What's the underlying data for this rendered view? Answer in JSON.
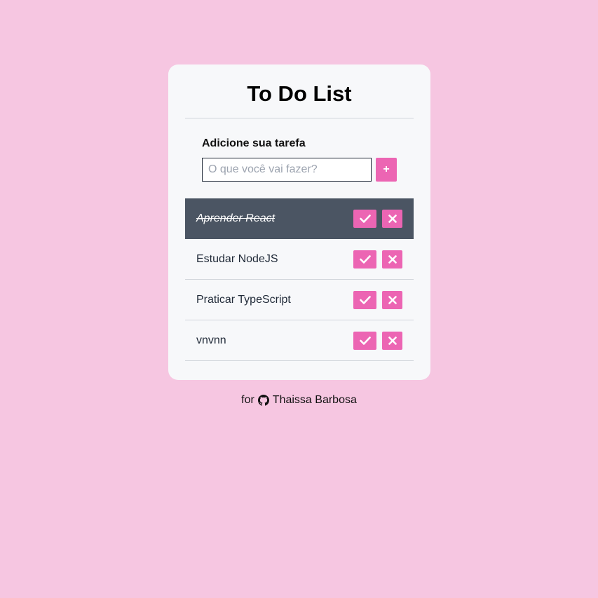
{
  "app": {
    "title": "To Do List"
  },
  "form": {
    "label": "Adicione sua tarefa",
    "input_value": "",
    "placeholder": "O que você vai fazer?",
    "add_button_label": "+"
  },
  "tasks": [
    {
      "text": "Aprender React",
      "done": true
    },
    {
      "text": "Estudar NodeJS",
      "done": false
    },
    {
      "text": "Praticar TypeScript",
      "done": false
    },
    {
      "text": "vnvnn",
      "done": false
    }
  ],
  "footer": {
    "prefix": "for",
    "icon": "github-icon",
    "author": "Thaissa Barbosa"
  },
  "colors": {
    "background": "#f6c6e1",
    "card": "#f7f8fa",
    "accent": "#ec65b3",
    "done_row": "#4b5563"
  }
}
